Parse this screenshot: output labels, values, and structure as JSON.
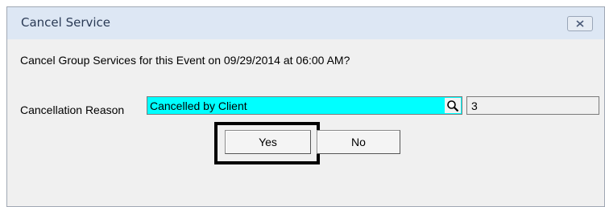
{
  "window": {
    "title": "Cancel Service",
    "close_icon": "close-x-icon"
  },
  "dialog": {
    "question": "Cancel Group Services for this Event on 09/29/2014 at 06:00 AM?",
    "reason_label": "Cancellation Reason",
    "reason_value": "Cancelled by Client",
    "reason_highlight_color": "#00ffff",
    "lookup_icon": "search-icon",
    "reason_code": "3"
  },
  "buttons": {
    "yes_label": "Yes",
    "no_label": "No"
  }
}
